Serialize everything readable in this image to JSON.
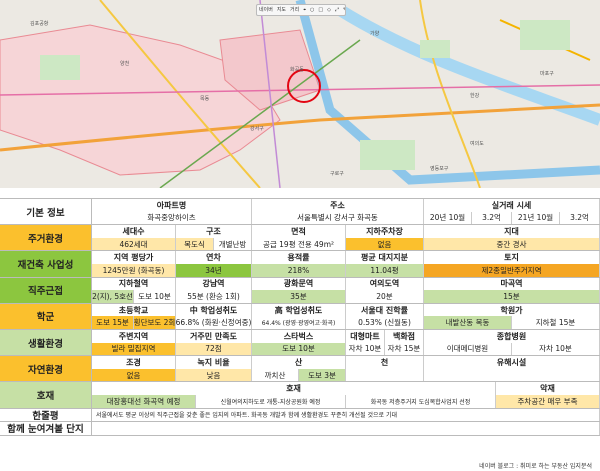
{
  "map": {
    "toolbar": [
      "네이버",
      "지도",
      "거리",
      "⌖",
      "○",
      "□",
      "◇",
      "⤢",
      "✎"
    ],
    "place_labels": [
      "양천",
      "목동",
      "화곡동",
      "김포공항",
      "강서구",
      "여의도",
      "영등포구",
      "구로구",
      "마포구",
      "한강",
      "가양"
    ]
  },
  "rows": [
    {
      "cat": "기본 정보",
      "cat_color": "#ffffff",
      "lines": [
        {
          "hdr": true,
          "cells": [
            {
              "t": "아파트명",
              "w": 160,
              "c": "#fff"
            },
            {
              "t": "주소",
              "w": 172,
              "c": "#fff"
            },
            {
              "t": "실거래 시세",
              "w": 176,
              "c": "#fff"
            }
          ]
        },
        {
          "cells": [
            {
              "t": "화곡중앙하이츠",
              "w": 160,
              "c": "#fff"
            },
            {
              "t": "서울특별시 강서구 화곡동",
              "w": 172,
              "c": "#fff"
            },
            {
              "t": "20년 10월",
              "w": 48,
              "c": "#fff"
            },
            {
              "t": "3.2억",
              "w": 40,
              "c": "#fff"
            },
            {
              "t": "21년 10월",
              "w": 48,
              "c": "#fff"
            },
            {
              "t": "3.2억",
              "w": 40,
              "c": "#fff"
            }
          ]
        }
      ]
    },
    {
      "cat": "주거환경",
      "cat_color": "#fbc02d",
      "lines": [
        {
          "hdr": true,
          "cells": [
            {
              "t": "세대수",
              "w": 84,
              "c": "#fff"
            },
            {
              "t": "구조",
              "w": 76,
              "c": "#fff"
            },
            {
              "t": "면적",
              "w": 94,
              "c": "#fff"
            },
            {
              "t": "지하주차장",
              "w": 78,
              "c": "#fff"
            },
            {
              "t": "지대",
              "w": 176,
              "c": "#fff"
            }
          ]
        },
        {
          "cells": [
            {
              "t": "462세대",
              "w": 84,
              "c": "#ffe7a8"
            },
            {
              "t": "복도식",
              "w": 38,
              "c": "#ffe7a8"
            },
            {
              "t": "개별난방",
              "w": 38,
              "c": "#fff"
            },
            {
              "t": "공급 19평  전용 49m²",
              "w": 94,
              "c": "#fff"
            },
            {
              "t": "없음",
              "w": 78,
              "c": "#fbc02d"
            },
            {
              "t": "중간 경사",
              "w": 176,
              "c": "#ffe7a8"
            }
          ]
        }
      ]
    },
    {
      "cat": "재건축 사업성",
      "cat_color": "#8cc63f",
      "lines": [
        {
          "hdr": true,
          "cells": [
            {
              "t": "지역 평당가",
              "w": 84,
              "c": "#fff"
            },
            {
              "t": "연차",
              "w": 76,
              "c": "#fff"
            },
            {
              "t": "용적률",
              "w": 94,
              "c": "#fff"
            },
            {
              "t": "평균 대지지분",
              "w": 78,
              "c": "#fff"
            },
            {
              "t": "토지",
              "w": 176,
              "c": "#fff"
            }
          ]
        },
        {
          "cells": [
            {
              "t": "1245만원 (화곡동)",
              "w": 84,
              "c": "#ffe7a8"
            },
            {
              "t": "34년",
              "w": 76,
              "c": "#8cc63f"
            },
            {
              "t": "218%",
              "w": 94,
              "c": "#c6e0a5"
            },
            {
              "t": "11.04평",
              "w": 78,
              "c": "#c6e0a5"
            },
            {
              "t": "제2종일반주거지역",
              "w": 176,
              "c": "#f5a623"
            }
          ]
        }
      ]
    },
    {
      "cat": "직주근접",
      "cat_color": "#8cc63f",
      "lines": [
        {
          "hdr": true,
          "cells": [
            {
              "t": "지하철역",
              "w": 84,
              "c": "#fff"
            },
            {
              "t": "강남역",
              "w": 76,
              "c": "#fff"
            },
            {
              "t": "광화문역",
              "w": 94,
              "c": "#fff"
            },
            {
              "t": "여의도역",
              "w": 78,
              "c": "#fff"
            },
            {
              "t": "마곡역",
              "w": 176,
              "c": "#fff"
            }
          ]
        },
        {
          "cells": [
            {
              "t": "2(지), 5호선",
              "w": 42,
              "c": "#c6e0a5"
            },
            {
              "t": "도보 10분",
              "w": 42,
              "c": "#fff"
            },
            {
              "t": "55분 (환승 1회)",
              "w": 76,
              "c": "#fff"
            },
            {
              "t": "35분",
              "w": 94,
              "c": "#c6e0a5"
            },
            {
              "t": "20분",
              "w": 78,
              "c": "#fff"
            },
            {
              "t": "15분",
              "w": 176,
              "c": "#c6e0a5"
            }
          ]
        }
      ]
    },
    {
      "cat": "학군",
      "cat_color": "#fbc02d",
      "lines": [
        {
          "hdr": true,
          "cells": [
            {
              "t": "초등학교",
              "w": 84,
              "c": "#fff"
            },
            {
              "t": "中 학업성취도",
              "w": 76,
              "c": "#fff"
            },
            {
              "t": "高 학업성취도",
              "w": 94,
              "c": "#fff"
            },
            {
              "t": "서울대 진학률",
              "w": 78,
              "c": "#fff"
            },
            {
              "t": "학원가",
              "w": 176,
              "c": "#fff"
            }
          ]
        },
        {
          "cells": [
            {
              "t": "도보 15분",
              "w": 42,
              "c": "#fbc02d"
            },
            {
              "t": "횡단보도 2회",
              "w": 42,
              "c": "#fbc02d"
            },
            {
              "t": "66.8% (화원·신정여중)",
              "w": 76,
              "c": "#fff"
            },
            {
              "t": "64.4% (광영·광영여고·화곡)",
              "w": 94,
              "c": "#fff"
            },
            {
              "t": "0.53% (신월동)",
              "w": 78,
              "c": "#fff"
            },
            {
              "t": "내발산동 목동",
              "w": 88,
              "c": "#c6e0a5"
            },
            {
              "t": "지하철 15분",
              "w": 88,
              "c": "#fff"
            }
          ]
        }
      ]
    },
    {
      "cat": "생활환경",
      "cat_color": "#c6e0a5",
      "lines": [
        {
          "hdr": true,
          "cells": [
            {
              "t": "주변지역",
              "w": 84,
              "c": "#fff"
            },
            {
              "t": "거주민 만족도",
              "w": 76,
              "c": "#fff"
            },
            {
              "t": "스타벅스",
              "w": 94,
              "c": "#fff"
            },
            {
              "t": "대형마트",
              "w": 39,
              "c": "#fff"
            },
            {
              "t": "백화점",
              "w": 39,
              "c": "#fff"
            },
            {
              "t": "종합병원",
              "w": 176,
              "c": "#fff"
            }
          ]
        },
        {
          "cells": [
            {
              "t": "빌라 밀집지역",
              "w": 84,
              "c": "#fbc02d"
            },
            {
              "t": "72점",
              "w": 76,
              "c": "#ffe7a8"
            },
            {
              "t": "도보 10분",
              "w": 94,
              "c": "#c6e0a5"
            },
            {
              "t": "자차 10분",
              "w": 39,
              "c": "#fff"
            },
            {
              "t": "자차 15분",
              "w": 39,
              "c": "#fff"
            },
            {
              "t": "이대메디병원",
              "w": 88,
              "c": "#fff"
            },
            {
              "t": "자차 10분",
              "w": 88,
              "c": "#fff"
            }
          ]
        }
      ]
    },
    {
      "cat": "자연환경",
      "cat_color": "#fbc02d",
      "lines": [
        {
          "hdr": true,
          "cells": [
            {
              "t": "조경",
              "w": 84,
              "c": "#fff"
            },
            {
              "t": "녹지 비율",
              "w": 76,
              "c": "#fff"
            },
            {
              "t": "산",
              "w": 94,
              "c": "#fff"
            },
            {
              "t": "천",
              "w": 78,
              "c": "#fff"
            },
            {
              "t": "유해시설",
              "w": 176,
              "c": "#fff"
            }
          ]
        },
        {
          "cells": [
            {
              "t": "없음",
              "w": 84,
              "c": "#fbc02d"
            },
            {
              "t": "낮음",
              "w": 76,
              "c": "#ffe7a8"
            },
            {
              "t": "까치산",
              "w": 47,
              "c": "#fff"
            },
            {
              "t": "도보 3분",
              "w": 47,
              "c": "#c6e0a5"
            },
            {
              "t": "",
              "w": 78,
              "c": "#fff"
            },
            {
              "t": "",
              "w": 176,
              "c": "#fff"
            }
          ]
        }
      ]
    },
    {
      "cat": "호재",
      "cat_color": "#c6e0a5",
      "lines": [
        {
          "hdr": true,
          "cells": [
            {
              "t": "호재",
              "w": 404,
              "c": "#fff"
            },
            {
              "t": "악재",
              "w": 104,
              "c": "#fff"
            }
          ]
        },
        {
          "cells": [
            {
              "t": "대장홍대선 화곡역 예정",
              "w": 104,
              "c": "#c6e0a5"
            },
            {
              "t": "신월여의지하도로 개통-지상공원화 예정",
              "w": 150,
              "c": "#fff"
            },
            {
              "t": "화곡동 저층주거지 도심복합사업지 선정",
              "w": 150,
              "c": "#fff"
            },
            {
              "t": "주차공간 매우 부족",
              "w": 104,
              "c": "#ffe7a8"
            }
          ]
        }
      ]
    },
    {
      "cat": "한줄평",
      "cat_color": "#ffffff",
      "lines": [
        {
          "cells": [
            {
              "t": "서울에서도 평균 이상의 직주근접을 갖춘 좋은 입지의 아파트. 화곡동 개발과 함께 생활환경도 꾸준히 개선될 것으로 기대",
              "w": 508,
              "c": "#fff",
              "left": true
            }
          ]
        }
      ]
    },
    {
      "cat": "함께 눈여겨볼 단지",
      "cat_color": "#ffffff",
      "lines": [
        {
          "cells": [
            {
              "t": "",
              "w": 508,
              "c": "#fff"
            }
          ]
        }
      ]
    }
  ],
  "footer": "네이버 블로그 : 취미로 하는 부동산 입지분석"
}
